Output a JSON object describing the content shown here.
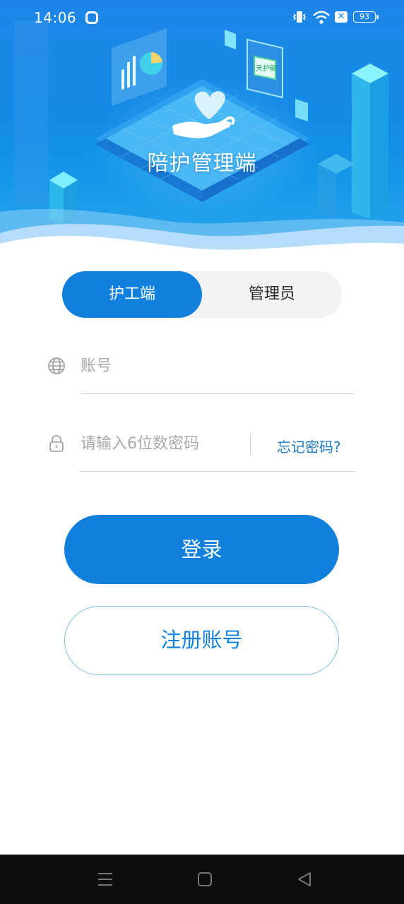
{
  "status_bar": {
    "time": "14:06",
    "battery": "93",
    "icons": [
      "app-icon",
      "vibrate-icon",
      "wifi-icon",
      "no-sim-icon",
      "battery-icon"
    ]
  },
  "hero": {
    "title": "陪护管理端",
    "badge_text": "天护能"
  },
  "role_tabs": {
    "nurse_label": "护工端",
    "admin_label": "管理员",
    "active": "护工端"
  },
  "form": {
    "account_placeholder": "账号",
    "password_placeholder": "请输入6位数密码",
    "forgot_label": "忘记密码?"
  },
  "buttons": {
    "login_label": "登录",
    "register_label": "注册账号"
  },
  "nav_bar": {
    "icons": [
      "menu-icon",
      "home-icon",
      "back-icon"
    ]
  },
  "colors": {
    "primary": "#1180dc",
    "header_top": "#1f86e8",
    "link": "#1c79c9"
  }
}
